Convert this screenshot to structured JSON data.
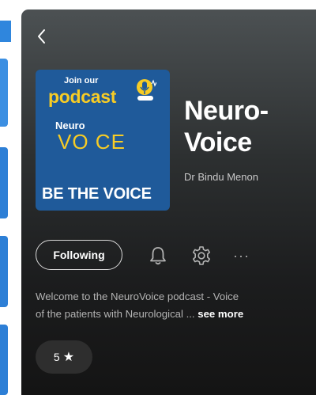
{
  "podcast": {
    "title_line1": "Neuro-",
    "title_line2": "Voice",
    "author": "Dr Bindu Menon",
    "cover": {
      "join_text": "Join our",
      "podcast_text": "podcast",
      "neuro_text": "Neuro",
      "voice_text": "VO CE",
      "tagline": "BE THE VOICE",
      "background_color": "#1f5a9a",
      "accent_color": "#f7cc25"
    }
  },
  "actions": {
    "follow_label": "Following",
    "notification_icon": "bell-icon",
    "settings_icon": "gear-icon",
    "more_label": "···"
  },
  "description": {
    "line1": "Welcome to the NeuroVoice podcast - Voice",
    "line2": "of the patients with Neurological ...",
    "see_more": "see more"
  },
  "rating": {
    "value": "5",
    "star": "★"
  },
  "colors": {
    "panel_top": "#4c5153",
    "panel_bottom": "#141414",
    "background_accent": "#2f86dd"
  }
}
